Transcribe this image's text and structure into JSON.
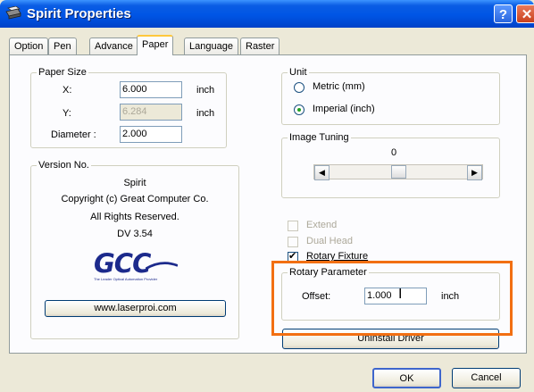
{
  "window": {
    "title": "Spirit Properties",
    "help_glyph": "?",
    "close_glyph": "✕"
  },
  "tabs": [
    "Option",
    "Pen",
    "Advance",
    "Paper",
    "Language",
    "Raster"
  ],
  "paper_size": {
    "legend": "Paper Size",
    "x_label": "X:",
    "x_value": "6.000",
    "x_unit": "inch",
    "y_label": "Y:",
    "y_value": "6.284",
    "y_unit": "inch",
    "diameter_label": "Diameter :",
    "diameter_value": "2.000"
  },
  "unit": {
    "legend": "Unit",
    "metric": "Metric (mm)",
    "imperial": "Imperial (inch)",
    "selected": "imperial"
  },
  "image_tuning": {
    "legend": "Image Tuning",
    "value": "0",
    "slider_fraction": 0.5,
    "left_arrow": "◀",
    "right_arrow": "▶"
  },
  "options": {
    "extend": "Extend",
    "dual_head": "Dual Head",
    "rotary_fixture": "Rotary Fixture"
  },
  "version": {
    "legend": "Version No.",
    "name": "Spirit",
    "copyright": "Copyright (c) Great Computer Co.",
    "rights": "All Rights Reserved.",
    "build": "DV 3.54",
    "logo_text": "GCC",
    "logo_tagline": "The Leader Optical Automation Provider",
    "website_button": "www.laserproi.com"
  },
  "rotary_parameter": {
    "legend": "Rotary Parameter",
    "offset_label": "Offset:",
    "offset_value": "1.000",
    "unit": "inch"
  },
  "uninstall_button": "Uninstall Driver",
  "ok_button": "OK",
  "cancel_button": "Cancel",
  "colors": {
    "highlight": "#f26f12",
    "title_bar": "#0055e5",
    "logo_blue": "#1c2a8c"
  }
}
